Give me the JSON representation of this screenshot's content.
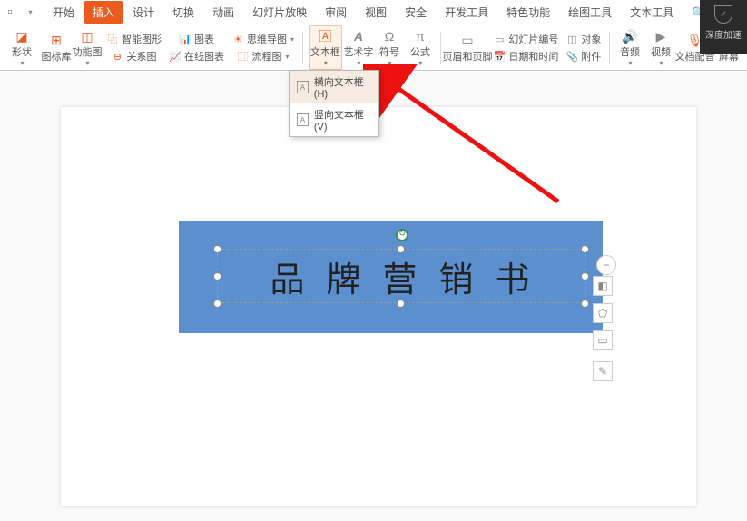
{
  "tabs": {
    "start": "开始",
    "insert": "插入",
    "design": "设计",
    "transition": "切换",
    "animation": "动画",
    "slideshow": "幻灯片放映",
    "review": "审阅",
    "view": "视图",
    "security": "安全",
    "developer": "开发工具",
    "special": "特色功能",
    "drawtools": "绘图工具",
    "texttools": "文本工具"
  },
  "search": {
    "label": "查找"
  },
  "darkpanel": {
    "label": "深度加速"
  },
  "ribbon": {
    "shapes": "形状",
    "iconlib": "图标库",
    "function": "功能图",
    "smartgraphic": "智能图形",
    "chart": "图表",
    "relation": "关系图",
    "mindmap": "思维导图",
    "onlinechart": "在线图表",
    "flowchart": "流程图",
    "textbox": "文本框",
    "wordart": "艺术字",
    "symbol": "符号",
    "formula": "公式",
    "headerfooter": "页眉和页脚",
    "slidenumber": "幻灯片编号",
    "datetime": "日期和时间",
    "object": "对象",
    "attachment": "附件",
    "audio": "音频",
    "video": "视频",
    "dubbing": "文档配音",
    "screen": "屏幕"
  },
  "dropdown": {
    "horizontal": "横向文本框(H)",
    "vertical": "竖向文本框(V)"
  },
  "slide": {
    "textbox_content": "品牌营销书"
  },
  "floattools": {
    "minus": "−",
    "layers": "◧",
    "shape": "⬠",
    "rect": "▭",
    "pencil": "✎"
  }
}
